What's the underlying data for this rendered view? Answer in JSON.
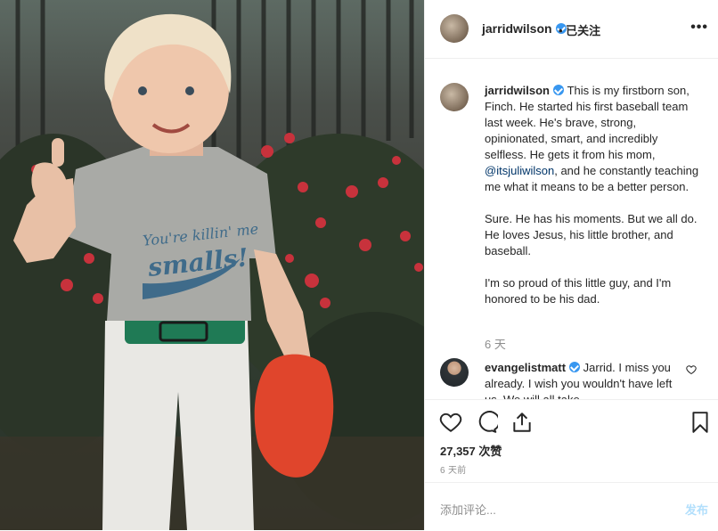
{
  "post": {
    "username": "jarridwilson",
    "follow_state": "• 已关注"
  },
  "caption": {
    "username": "jarridwilson",
    "p1_before": "This is my firstborn son, Finch. He started his first baseball team last week. He's brave, strong, opinionated, smart, and incredibly selfless. He gets it from his mom, ",
    "mention": "@itsjuliwilson",
    "p1_after": ", and he constantly teaching me what it means to be a better person.",
    "p2": "Sure. He has his moments. But we all do. He loves Jesus, his little brother, and baseball.",
    "p3": "I'm so proud of this little guy, and I'm honored to be his dad.",
    "age": "6 天"
  },
  "comment": {
    "username": "evangelistmatt",
    "text": "Jarrid. I miss you already. I wish you wouldn't have left us. We will all take"
  },
  "photo": {
    "shirt_line1": "You're killin' me",
    "shirt_line2": "smalls!"
  },
  "actions": {
    "likes": "27,357 次赞",
    "time": "6 天前"
  },
  "add_comment": {
    "placeholder": "添加评论...",
    "post_label": "发布"
  },
  "icons": [
    "more-icon",
    "verified-icon",
    "heart-icon",
    "comment-icon",
    "share-icon",
    "bookmark-icon"
  ],
  "colors": {
    "verified": "#3897f0",
    "mention": "#003569",
    "muted": "#8e8e8e",
    "post_disabled": "#b2dffc"
  }
}
